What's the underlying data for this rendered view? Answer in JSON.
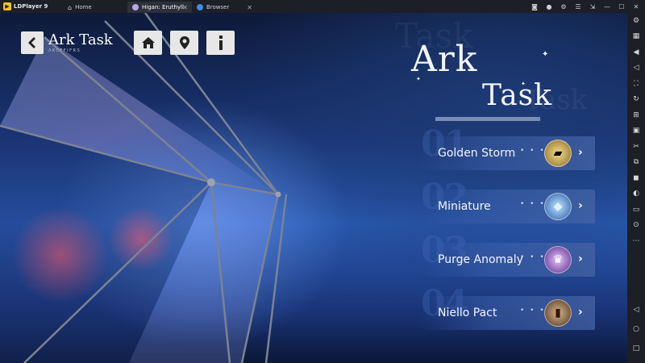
{
  "emulator": {
    "brand": "LDPlayer 9",
    "tabs": [
      {
        "label": "Home",
        "icon": "home-icon"
      },
      {
        "label": "Higan: Eruthyll",
        "icon": "game-icon"
      },
      {
        "label": "Browser",
        "icon": "browser-icon"
      }
    ]
  },
  "header": {
    "title": "Ark Task",
    "subtitle": "ΛKCFFIFRS"
  },
  "hero": {
    "word1": "Ark",
    "word2": "Task"
  },
  "tasks": [
    {
      "number": "01",
      "label": "Golden Storm",
      "item": "gold-ticket-icon",
      "orb_color": "#e8c86a"
    },
    {
      "number": "02",
      "label": "Miniature",
      "item": "blue-crystal-icon",
      "orb_color": "#6cb8ff"
    },
    {
      "number": "03",
      "label": "Purge Anomaly",
      "item": "purple-crest-icon",
      "orb_color": "#b06cd8"
    },
    {
      "number": "04",
      "label": "Niello Pact",
      "item": "tome-icon",
      "orb_color": "#a07850"
    }
  ],
  "colors": {
    "accent": "#2a5bb4",
    "panel": "#46649f",
    "button": "#e7e7e7"
  }
}
